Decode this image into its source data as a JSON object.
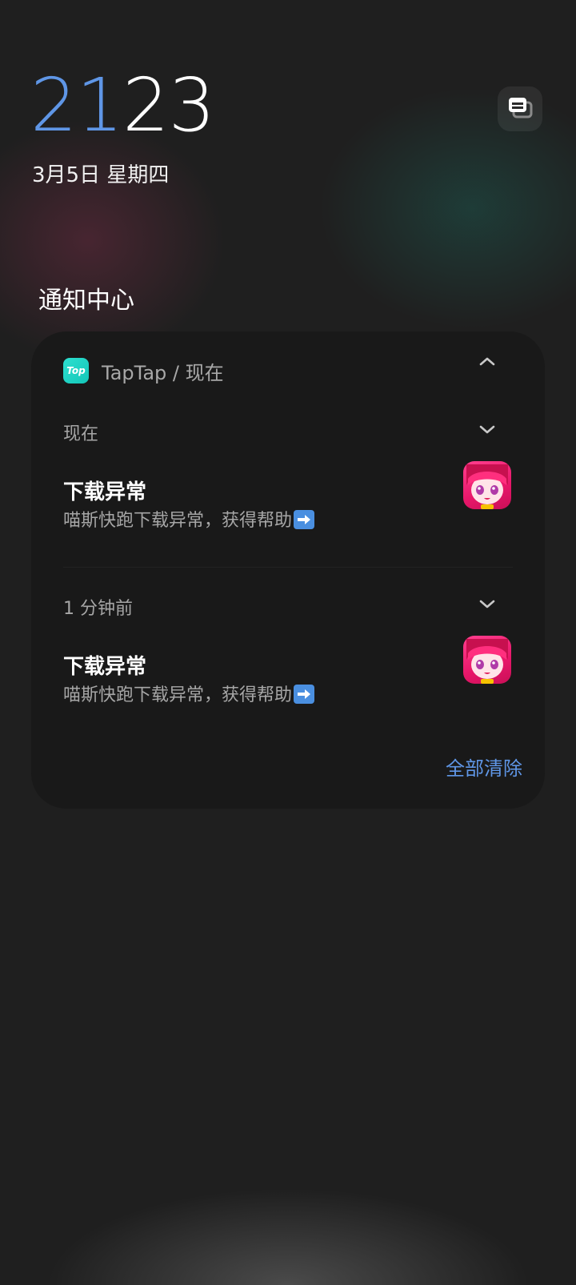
{
  "lockscreen": {
    "clock_hours": "21",
    "clock_minutes": "23",
    "date": "3月5日 星期四"
  },
  "notification_center": {
    "title": "通知中心",
    "clear_all_label": "全部清除"
  },
  "app_group": {
    "app_icon_text": "Top",
    "header": "TapTap / 现在",
    "icon": "taptap-app-icon",
    "colors": {
      "app_icon": "#1ed4c4",
      "accent": "#5f96e6"
    }
  },
  "notifications": [
    {
      "time": "现在",
      "title": "下载异常",
      "body": "喵斯快跑下载异常，获得帮助",
      "thumbnail": "muse-dash-game-icon"
    },
    {
      "time": "1 分钟前",
      "title": "下载异常",
      "body": "喵斯快跑下载异常，获得帮助",
      "thumbnail": "muse-dash-game-icon"
    }
  ]
}
